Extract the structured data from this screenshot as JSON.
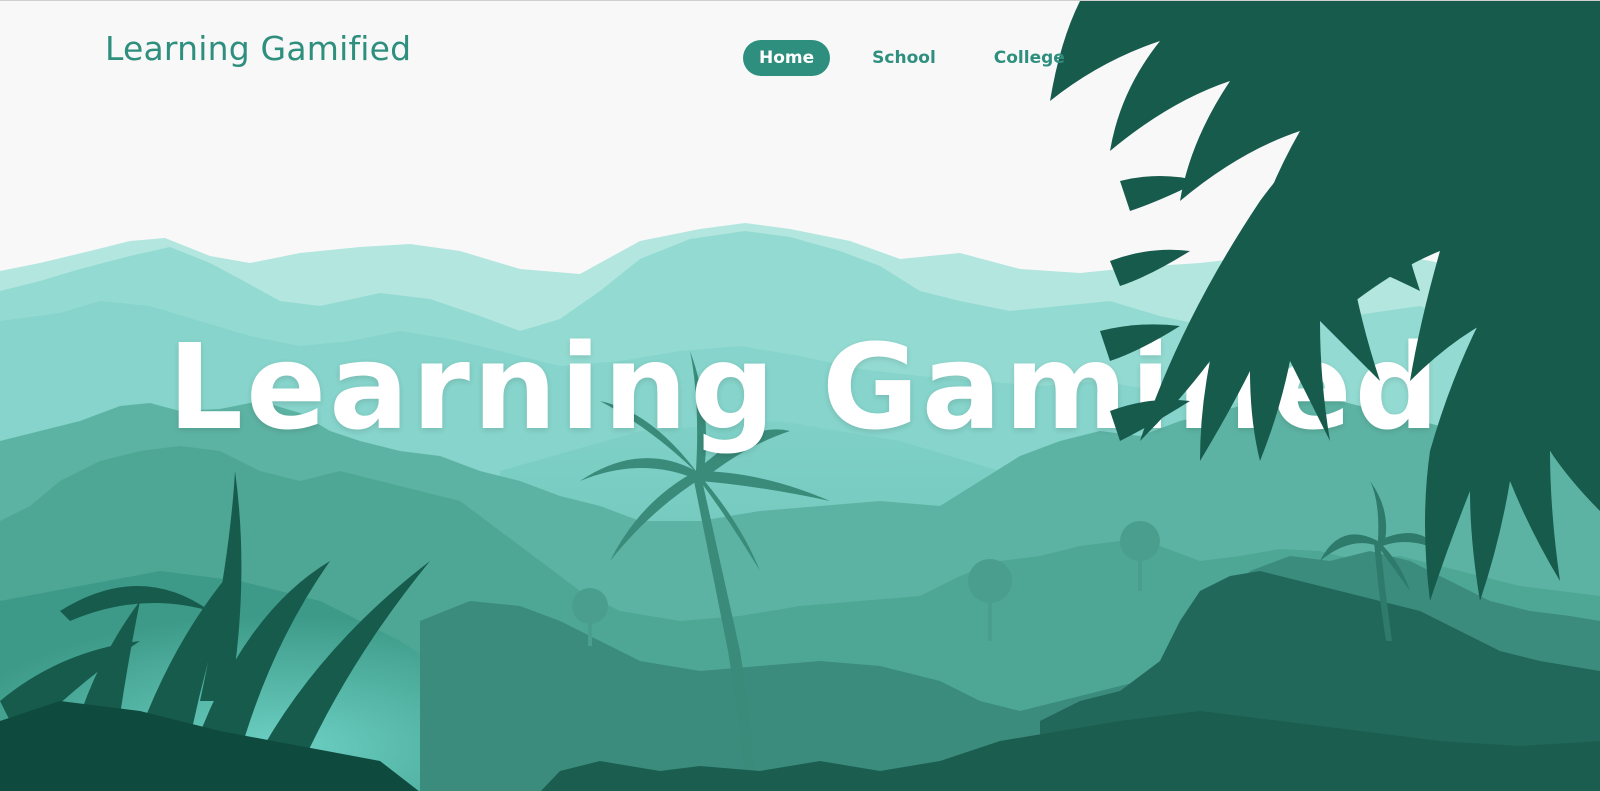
{
  "brand": {
    "title": "Learning Gamified"
  },
  "nav": {
    "items": [
      {
        "label": "Home",
        "active": true
      },
      {
        "label": "School",
        "active": false
      },
      {
        "label": "College",
        "active": false
      }
    ]
  },
  "hero": {
    "title": "Learning Gamified"
  },
  "colors": {
    "accent": "#2f8f7e",
    "background": "#f8f8f8",
    "mountain_light": "#b2e6df",
    "mountain_mid": "#8fd8cf",
    "forest_mid": "#4ea695",
    "forest_dark": "#1f5f52",
    "fern": "#175b4d"
  }
}
